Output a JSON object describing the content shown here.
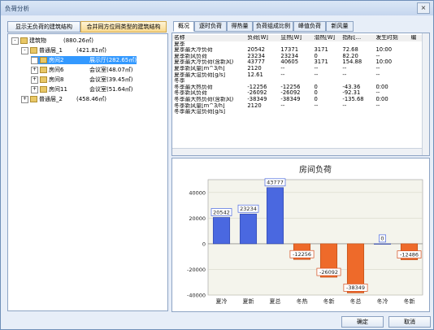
{
  "window": {
    "title": "负荷分析",
    "close_glyph": "×"
  },
  "left_buttons": {
    "show_no_load": "显示无负荷的建筑结构",
    "merge": "合并同方位同类型的建筑结构"
  },
  "tree": [
    {
      "label": "建筑物",
      "value": "(880.26㎡)",
      "level": 0,
      "sign": "-"
    },
    {
      "label": "普通层_1",
      "value": "(421.81㎡)",
      "level": 1,
      "sign": "-"
    },
    {
      "label": "房间2",
      "value": "展示厅(282.65㎡)",
      "level": 2,
      "sign": "+",
      "selected": true
    },
    {
      "label": "房间6",
      "value": "会议室(48.07㎡)",
      "level": 2,
      "sign": "+"
    },
    {
      "label": "房间8",
      "value": "会议室(39.45㎡)",
      "level": 2,
      "sign": "+"
    },
    {
      "label": "房间11",
      "value": "会议室(51.64㎡)",
      "level": 2,
      "sign": "+"
    },
    {
      "label": "普通层_2",
      "value": "(458.46㎡)",
      "level": 1,
      "sign": "+"
    }
  ],
  "tabs": [
    "概况",
    "逐时负荷",
    "得热量",
    "负荷组成比例",
    "峰值负荷",
    "新风量"
  ],
  "table": {
    "headers": [
      "名称",
      "负荷[W]",
      "显热[W]",
      "潜热[W]",
      "指标[...",
      "发生时刻",
      "编"
    ],
    "rows": [
      [
        "夏季",
        "",
        "",
        "",
        "",
        "",
        ""
      ],
      [
        "夏季最大冷负荷",
        "20542",
        "17371",
        "3171",
        "72.68",
        "10:00",
        ""
      ],
      [
        "夏季新风负荷",
        "23234",
        "23234",
        "0",
        "82.20",
        "--",
        ""
      ],
      [
        "夏季最大冷负荷(含新风)",
        "43777",
        "40605",
        "3171",
        "154.88",
        "10:00",
        ""
      ],
      [
        "夏季新风量[m^3/h]",
        "2120",
        "--",
        "--",
        "--",
        "--",
        ""
      ],
      [
        "夏季最大湿负荷[g/s]",
        "12.61",
        "--",
        "--",
        "--",
        "--",
        ""
      ],
      [
        "冬季",
        "",
        "",
        "",
        "",
        "",
        ""
      ],
      [
        "冬季最大热负荷",
        "-12256",
        "-12256",
        "0",
        "-43.36",
        "0:00",
        ""
      ],
      [
        "冬季新风负荷",
        "-26092",
        "-26092",
        "0",
        "-92.31",
        "--",
        ""
      ],
      [
        "冬季最大热负荷(含新风)",
        "-38349",
        "-38349",
        "0",
        "-135.68",
        "0:00",
        ""
      ],
      [
        "冬季新风量[m^3/h]",
        "2120",
        "--",
        "--",
        "--",
        "--",
        ""
      ],
      [
        "冬季最大湿负荷[g/s]",
        "",
        "",
        "",
        "",
        "",
        ""
      ]
    ]
  },
  "chart_data": {
    "type": "bar",
    "title": "房间负荷",
    "categories": [
      "夏冷",
      "夏新",
      "夏总",
      "冬热",
      "冬新",
      "冬总",
      "冬冷",
      "冬新"
    ],
    "values": [
      20542,
      23234,
      43777,
      -12256,
      -26092,
      -38349,
      0,
      -12486
    ],
    "ylim": [
      -40000,
      50000
    ],
    "yticks": [
      40000,
      20000,
      0,
      -20000,
      -40000
    ],
    "colors": {
      "positive": "#4a68e0",
      "negative": "#ee6a2a",
      "pos_label_border": "#4a68e0",
      "neg_label_border": "#d44c1c"
    }
  },
  "footer": {
    "ok": "确定",
    "cancel": "取消"
  }
}
